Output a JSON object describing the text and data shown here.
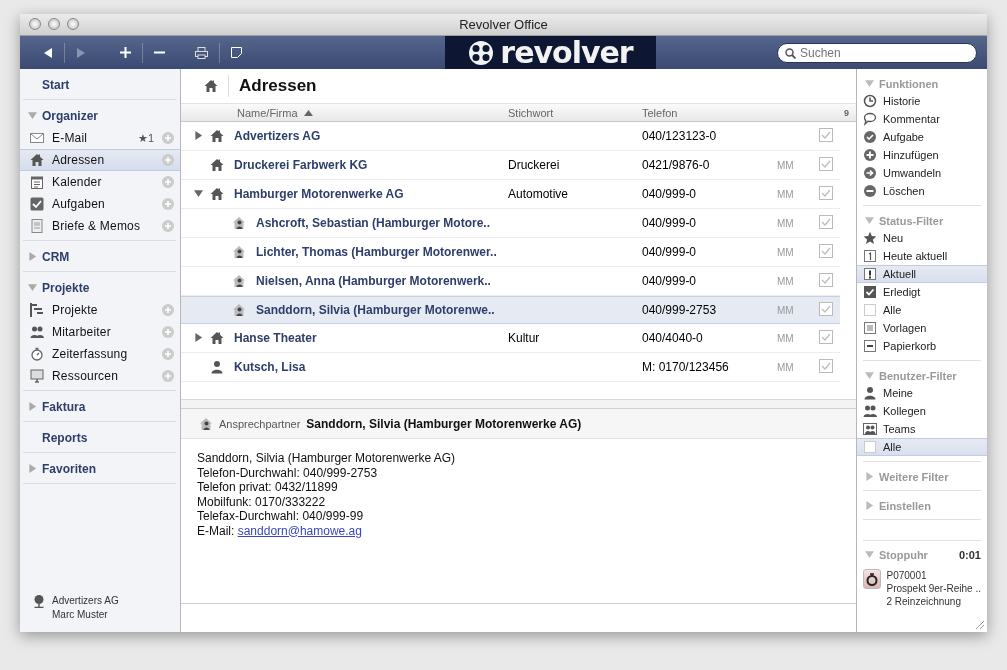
{
  "window": {
    "title": "Revolver Office"
  },
  "toolbar": {
    "logo": "revolver",
    "search": {
      "placeholder": "Suchen"
    }
  },
  "sidebar": {
    "sections": [
      {
        "kind": "link",
        "label": "Start"
      },
      {
        "kind": "group",
        "label": "Organizer",
        "expanded": true,
        "items": [
          {
            "label": "E-Mail",
            "badge": "★1",
            "selected": false
          },
          {
            "label": "Adressen",
            "selected": true
          },
          {
            "label": "Kalender",
            "selected": false
          },
          {
            "label": "Aufgaben",
            "selected": false
          },
          {
            "label": "Briefe & Memos",
            "selected": false
          }
        ]
      },
      {
        "kind": "group",
        "label": "CRM",
        "expanded": false
      },
      {
        "kind": "group",
        "label": "Projekte",
        "expanded": true,
        "items": [
          {
            "label": "Projekte",
            "selected": false
          },
          {
            "label": "Mitarbeiter",
            "selected": false
          },
          {
            "label": "Zeiterfassung",
            "selected": false
          },
          {
            "label": "Ressourcen",
            "selected": false
          }
        ]
      },
      {
        "kind": "group",
        "label": "Faktura",
        "expanded": false
      },
      {
        "kind": "link",
        "label": "Reports"
      },
      {
        "kind": "group",
        "label": "Favoriten",
        "expanded": false
      }
    ],
    "footer": {
      "company": "Advertizers AG",
      "user": "Marc Muster"
    }
  },
  "main": {
    "title": "Adressen",
    "columns": [
      {
        "label": "Name/Firma",
        "sorted": true
      },
      {
        "label": "Stichwort",
        "sorted": false
      },
      {
        "label": "Telefon",
        "sorted": false
      }
    ],
    "count": "9",
    "rows": [
      {
        "kind": "company",
        "name": "Advertizers AG",
        "keyword": "",
        "phone": "040/123123-0",
        "initials": "",
        "checked": true,
        "selected": false,
        "expanded": false
      },
      {
        "kind": "company",
        "name": "Druckerei Farbwerk KG",
        "keyword": "Druckerei",
        "phone": "0421/9876-0",
        "initials": "MM",
        "checked": true,
        "selected": false
      },
      {
        "kind": "company",
        "name": "Hamburger Motorenwerke AG",
        "keyword": "Automotive",
        "phone": "040/999-0",
        "initials": "MM",
        "checked": true,
        "selected": false,
        "expanded": true,
        "children": [
          {
            "kind": "contact",
            "name": "Ashcroft, Sebastian (Hamburger Motore..",
            "phone": "040/999-0",
            "initials": "MM",
            "checked": true,
            "selected": false
          },
          {
            "kind": "contact",
            "name": "Lichter, Thomas (Hamburger Motorenwer..",
            "phone": "040/999-0",
            "initials": "MM",
            "checked": true,
            "selected": false
          },
          {
            "kind": "contact",
            "name": "Nielsen, Anna (Hamburger Motorenwerk..",
            "phone": "040/999-0",
            "initials": "MM",
            "checked": true,
            "selected": false
          },
          {
            "kind": "contact",
            "name": "Sanddorn, Silvia (Hamburger Motorenwe..",
            "phone": "040/999-2753",
            "initials": "MM",
            "checked": true,
            "selected": true
          }
        ]
      },
      {
        "kind": "company",
        "name": "Hanse Theater",
        "keyword": "Kultur",
        "phone": "040/4040-0",
        "initials": "MM",
        "checked": true,
        "selected": false,
        "expanded": false
      },
      {
        "kind": "person",
        "name": "Kutsch, Lisa",
        "keyword": "",
        "phone": "M: 0170/123456",
        "initials": "MM",
        "checked": true,
        "selected": false
      }
    ],
    "detail": {
      "label": "Ansprechpartner",
      "name": "Sanddorn, Silvia (Hamburger Motorenwerke AG)",
      "lines": [
        "Sanddorn, Silvia (Hamburger Motorenwerke AG)",
        "Telefon-Durchwahl: 040/999-2753",
        "Telefon privat: 0432/11899",
        "Mobilfunk: 0170/333222",
        "Telefax-Durchwahl: 040/999-99"
      ],
      "email_label": "E-Mail:",
      "email": "sanddorn@hamowe.ag"
    }
  },
  "panel": {
    "sections": [
      {
        "title": "Funktionen",
        "expanded": true,
        "items": [
          {
            "label": "Historie",
            "selected": false
          },
          {
            "label": "Kommentar",
            "selected": false
          },
          {
            "label": "Aufgabe",
            "selected": false
          },
          {
            "label": "Hinzufügen",
            "selected": false
          },
          {
            "label": "Umwandeln",
            "selected": false
          },
          {
            "label": "Löschen",
            "selected": false
          }
        ]
      },
      {
        "title": "Status-Filter",
        "expanded": true,
        "items": [
          {
            "label": "Neu",
            "selected": false
          },
          {
            "label": "Heute aktuell",
            "selected": false
          },
          {
            "label": "Aktuell",
            "selected": true
          },
          {
            "label": "Erledigt",
            "selected": false
          },
          {
            "label": "Alle",
            "selected": false
          },
          {
            "label": "Vorlagen",
            "selected": false
          },
          {
            "label": "Papierkorb",
            "selected": false
          }
        ]
      },
      {
        "title": "Benutzer-Filter",
        "expanded": true,
        "items": [
          {
            "label": "Meine",
            "selected": false
          },
          {
            "label": "Kollegen",
            "selected": false
          },
          {
            "label": "Teams",
            "selected": false
          },
          {
            "label": "Alle",
            "selected": true
          }
        ]
      },
      {
        "title": "Weitere Filter",
        "expanded": false
      },
      {
        "title": "Einstellen",
        "expanded": false
      }
    ],
    "stopwatch": {
      "title": "Stoppuhr",
      "expanded": true,
      "time": "0:01",
      "lines": [
        "P070001",
        "Prospekt 9er-Reihe ..",
        "2 Reinzeichnung"
      ]
    }
  }
}
